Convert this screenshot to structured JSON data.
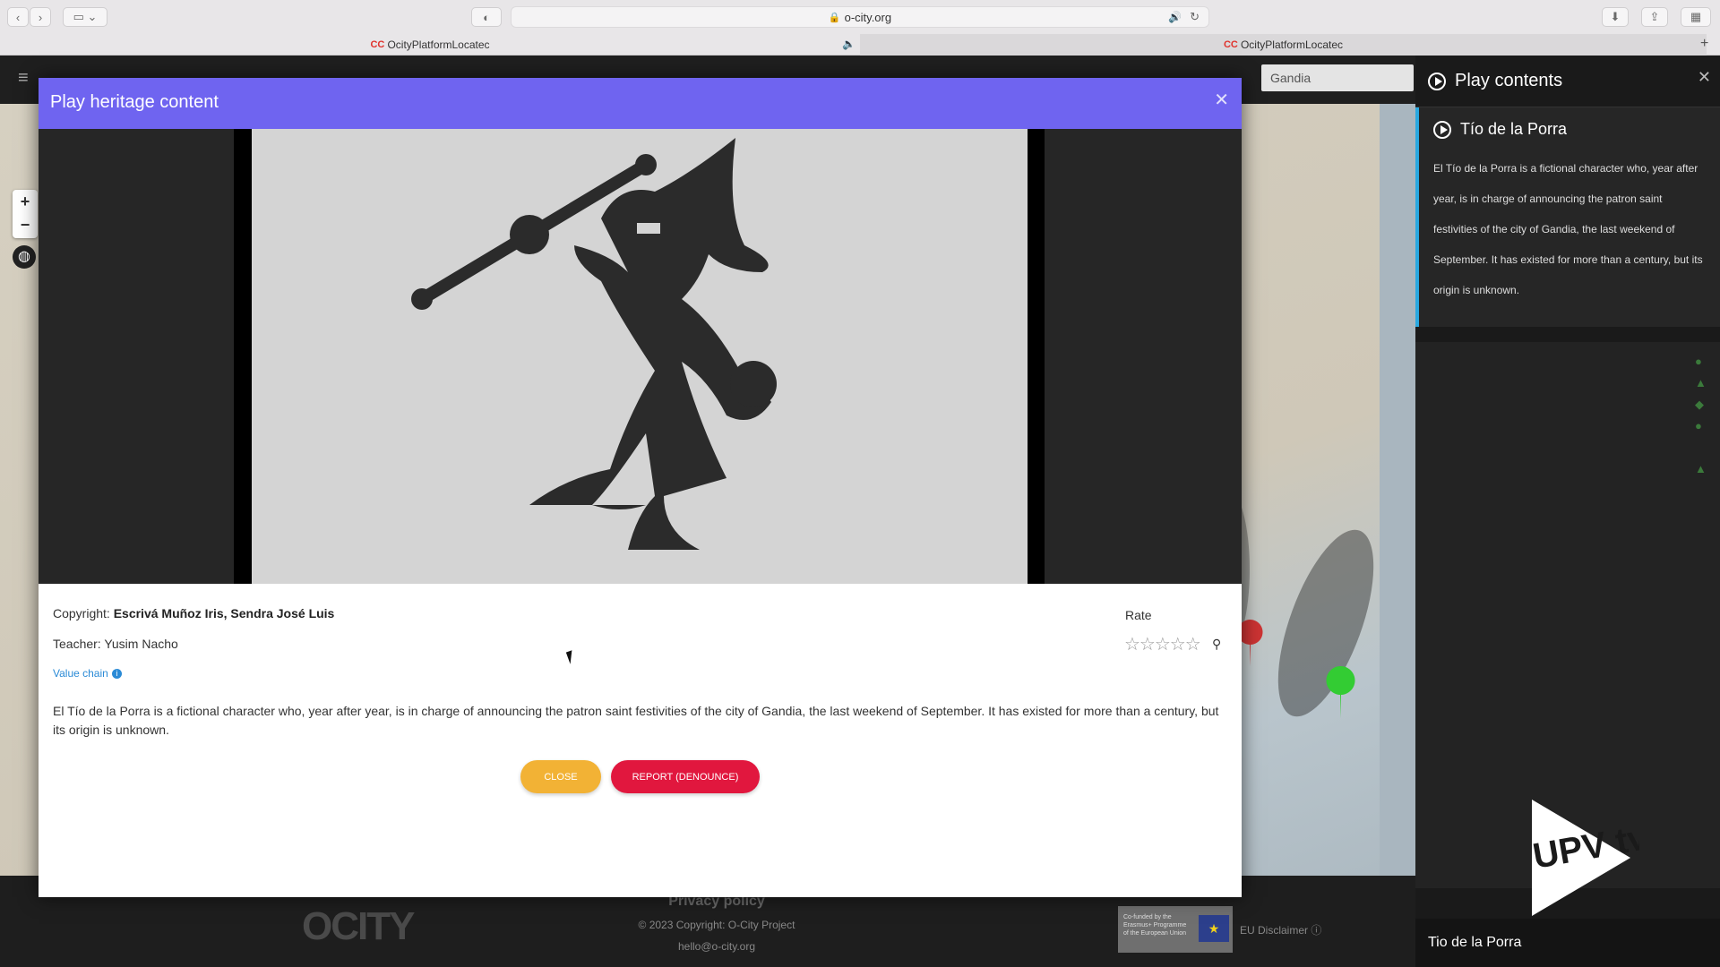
{
  "browser": {
    "url": "o-city.org",
    "tabs": [
      {
        "title": "OcityPlatformLocatec"
      },
      {
        "title": "OcityPlatformLocatec"
      }
    ]
  },
  "app": {
    "search_value": "Gandia",
    "zoom_in": "+",
    "zoom_out": "−",
    "footer": {
      "logo": "OCITY",
      "privacy": "Privacy policy",
      "copyright": "© 2023 Copyright: O-City Project",
      "email": "hello@o-city.org",
      "eu_box": "Co-funded by the Erasmus+ Programme of the European Union",
      "eu_disclaimer": "EU Disclaimer"
    }
  },
  "right_panel": {
    "title": "Play contents",
    "item": {
      "title": "Tío de la Porra",
      "text": "El Tío de la Porra is a fictional character who, year after year, is in charge of announcing the patron saint festivities of the city of Gandia, the last weekend of September. It has existed for more than a century, but its origin is unknown."
    },
    "bottom_caption": "Tio de la Porra",
    "watermark": "UPV tv"
  },
  "modal": {
    "title": "Play heritage content",
    "copyright_label": "Copyright:",
    "copyright_value": "Escrivá Muñoz Iris, Sendra José Luis",
    "teacher": "Teacher: Yusim Nacho",
    "value_chain": "Value chain",
    "description": "El Tío de la Porra is a fictional character who, year after year, is in charge of announcing the patron saint festivities of the city of Gandia, the last weekend of September. It has existed for more than a century, but its origin is unknown.",
    "rate_label": "Rate",
    "rating": 0,
    "stars": "☆☆☆☆☆",
    "close_label": "CLOSE",
    "report_label": "REPORT (DENOUNCE)"
  },
  "colors": {
    "modal_header": "#6f64f0",
    "close_button": "#f2b235",
    "report_button": "#e1173e",
    "accent_bar": "#29a8e0"
  }
}
